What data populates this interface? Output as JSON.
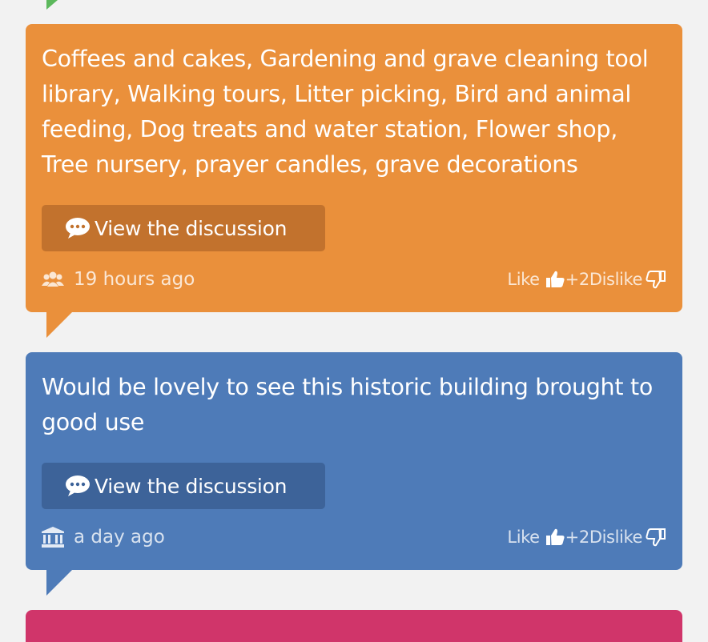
{
  "colors": {
    "orange": "#ea903b",
    "blue": "#4e7bb8",
    "pink": "#d0356a",
    "green": "#5cb85c"
  },
  "cards": [
    {
      "text": "Coffees and cakes, Gardening and grave cleaning tool library, Walking tours, Litter picking, Bird and animal feeding, Dog treats and water station, Flower shop, Tree nursery, prayer candles, grave decorations",
      "button": "View the discussion",
      "icon": "people-icon",
      "time": "19 hours ago",
      "like": "Like",
      "score": "+2",
      "dislike": "Dislike"
    },
    {
      "text": "Would be lovely to see this historic building brought to good use",
      "button": "View the discussion",
      "icon": "building-icon",
      "time": "a day ago",
      "like": "Like",
      "score": "+2",
      "dislike": "Dislike"
    }
  ]
}
